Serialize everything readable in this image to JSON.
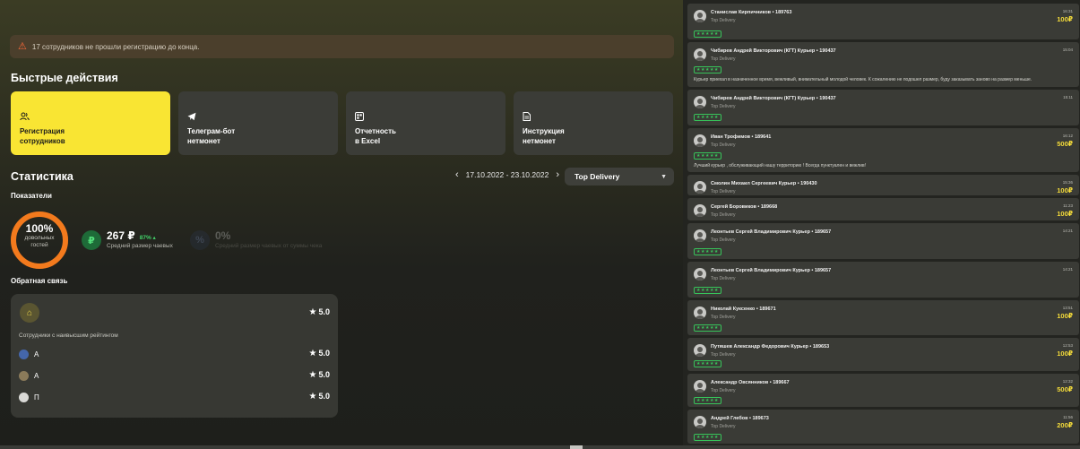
{
  "alert": {
    "text": "17 сотрудников не прошли регистрацию до конца."
  },
  "quick_actions": {
    "title": "Быстрые действия",
    "items": [
      {
        "line1": "Регистрация",
        "line2": "сотрудников",
        "icon": "users-icon"
      },
      {
        "line1": "Телеграм-бот",
        "line2": "нетмонет",
        "icon": "telegram-icon"
      },
      {
        "line1": "Отчетность",
        "line2": "в Excel",
        "icon": "excel-icon"
      },
      {
        "line1": "Инструкция",
        "line2": "нетмонет",
        "icon": "document-icon"
      }
    ]
  },
  "stats": {
    "title": "Статистика",
    "date_range": "17.10.2022 - 23.10.2022",
    "company": "Top Delivery",
    "indicators_title": "Показатели",
    "satisfaction": {
      "value": "100%",
      "label1": "довольных",
      "label2": "гостей",
      "fraction": 1.0
    },
    "avg_tip": {
      "value": "267 ₽",
      "change": "87% ▴",
      "label": "Средний размер чаевых"
    },
    "tip_share": {
      "value": "0%",
      "label": "Средний размер чаевых от суммы чека"
    }
  },
  "feedback": {
    "title": "Обратная связь",
    "overall_score": "5.0",
    "subtitle": "Сотрудники с наивысшим рейтингом",
    "rows": [
      {
        "name": "А",
        "score": "5.0"
      },
      {
        "name": "А",
        "score": "5.0"
      },
      {
        "name": "П",
        "score": "5.0"
      }
    ]
  },
  "reviews": [
    {
      "name": "Станислав Кирпичников • 189763",
      "company": "Top Delivery",
      "time": "16:31",
      "tip": "100₽",
      "stars": "★★★★★",
      "comment": ""
    },
    {
      "name": "Чибирев Андрей Викторович (КГТ) Курьер • 190437",
      "company": "Top Delivery",
      "time": "15:04",
      "tip": "",
      "stars": "★★★★★",
      "comment": "Курьер приехал в назначенное время, вежливый, внимательный молодой человек. К сожалению не подошел размер, буду заказывать заново на размер меньше."
    },
    {
      "name": "Чибирев Андрей Викторович (КГТ) Курьер • 190437",
      "company": "Top Delivery",
      "time": "15:11",
      "tip": "",
      "stars": "★★★★★",
      "comment": ""
    },
    {
      "name": "Иван Трофимов • 189641",
      "company": "Top Delivery",
      "time": "16:12",
      "tip": "500₽",
      "stars": "★★★★★",
      "comment": "Лучший курьер , обслуживающий нашу территорию ! Всегда пунктуален и вежлив!"
    },
    {
      "name": "Смолин Михаил Сергеевич Курьер • 190430",
      "company": "Top Delivery",
      "time": "15:36",
      "tip": "100₽",
      "stars": "",
      "comment": ""
    },
    {
      "name": "Сергей Боровиков • 189668",
      "company": "Top Delivery",
      "time": "11:23",
      "tip": "100₽",
      "stars": "",
      "comment": ""
    },
    {
      "name": "Леонтьев Сергей Владимирович Курьер • 189657",
      "company": "Top Delivery",
      "time": "14:21",
      "tip": "",
      "stars": "★★★★★",
      "comment": ""
    },
    {
      "name": "Леонтьев Сергей Владимирович Курьер • 189657",
      "company": "Top Delivery",
      "time": "14:21",
      "tip": "",
      "stars": "★★★★★",
      "comment": ""
    },
    {
      "name": "Николай Куксенко • 189671",
      "company": "Top Delivery",
      "time": "13:51",
      "tip": "100₽",
      "stars": "★★★★★",
      "comment": ""
    },
    {
      "name": "Путяшев Александр Федорович Курьер • 189653",
      "company": "Top Delivery",
      "time": "12:53",
      "tip": "100₽",
      "stars": "★★★★★",
      "comment": ""
    },
    {
      "name": "Александр Овсянников • 189667",
      "company": "Top Delivery",
      "time": "12:32",
      "tip": "500₽",
      "stars": "★★★★★",
      "comment": ""
    },
    {
      "name": "Андрей Глебов • 189673",
      "company": "Top Delivery",
      "time": "11:56",
      "tip": "200₽",
      "stars": "★★★★★",
      "comment": ""
    }
  ],
  "colors": {
    "accent": "#f9e533",
    "ring": "#f37a1d",
    "star_green": "#37c45a",
    "tip_yellow": "#f5dc3a"
  }
}
